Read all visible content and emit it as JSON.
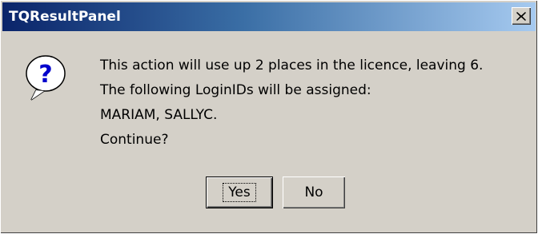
{
  "window": {
    "title": "TQResultPanel",
    "close_icon": "close-icon"
  },
  "dialog": {
    "icon": "question-icon",
    "icon_glyph": "?",
    "lines": [
      "This action will use up 2 places in the licence, leaving 6.",
      "The following LoginIDs will be assigned:",
      "MARIAM, SALLYC.",
      "Continue?"
    ]
  },
  "buttons": {
    "yes_label": "Yes",
    "no_label": "No"
  }
}
